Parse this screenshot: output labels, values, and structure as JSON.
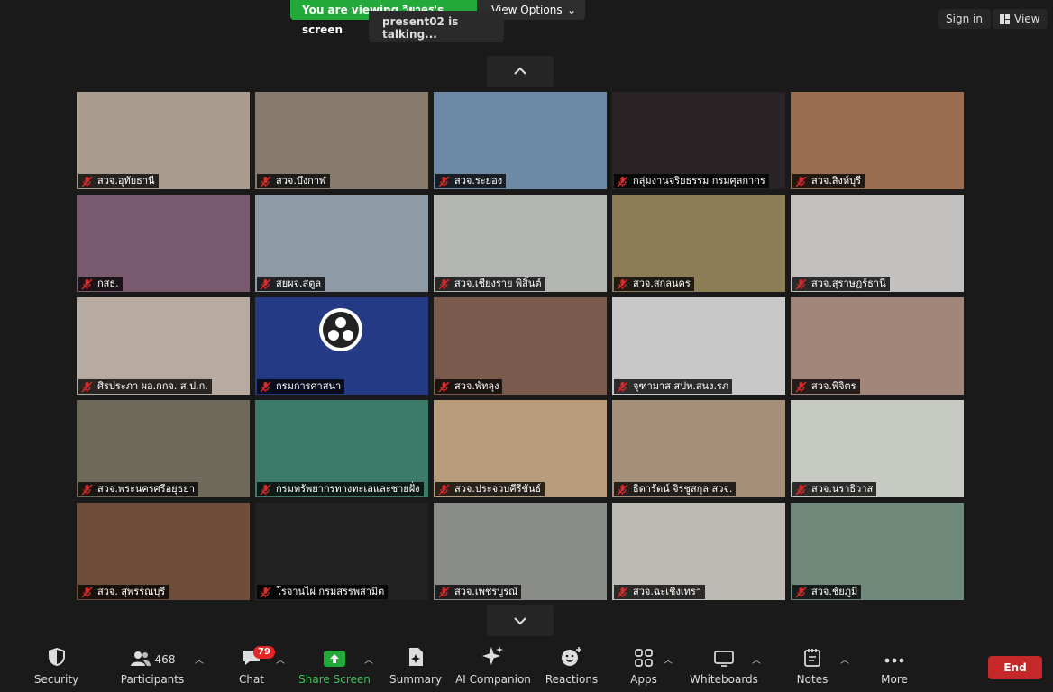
{
  "banner": {
    "viewing_text": "You are viewing วิยาคร's screen",
    "view_options_label": "View Options",
    "talking_text": "present02 is talking..."
  },
  "top_right": {
    "sign_in_label": "Sign in",
    "view_label": "View"
  },
  "participants_grid": [
    {
      "name": "สวจ.อุทัยธานี",
      "bg": "#a99b8e"
    },
    {
      "name": "สวจ.บึงกาฬ",
      "bg": "#857a6b"
    },
    {
      "name": "สวจ.ระยอง",
      "bg": "#6c8aa6"
    },
    {
      "name": "กลุ่มงานจริยธรรม กรมศุลกากร",
      "bg": "#2a2426"
    },
    {
      "name": "สวจ.สิงห์บุรี",
      "bg": "#9b6e52"
    },
    {
      "name": "กสธ.",
      "bg": "#7a5a6e"
    },
    {
      "name": "สยผจ.สตูล",
      "bg": "#8e9aa6"
    },
    {
      "name": "สวจ.เชียงราย พิสิ้นต์",
      "bg": "#b2b5b0"
    },
    {
      "name": "สวจ.สกลนคร",
      "bg": "#8c7d57"
    },
    {
      "name": "สวจ.สุราษฎร์ธานี",
      "bg": "#c3c1bf"
    },
    {
      "name": "ศิรประภา ผอ.กกจ. ส.ป.ก.",
      "bg": "#b7aaa0"
    },
    {
      "name": "กรมการศาสนา",
      "bg": "#253a84"
    },
    {
      "name": "สวจ.พัทลุง",
      "bg": "#7b5a4e"
    },
    {
      "name": "จุฑามาส สปท.สนง.รภ",
      "bg": "#c9c8c8"
    },
    {
      "name": "สวจ.พิจิตร",
      "bg": "#a3867a"
    },
    {
      "name": "สวจ.พระนครศรีอยุธยา",
      "bg": "#6f6959"
    },
    {
      "name": "กรมทรัพยากรทางทะเลและชายฝั่ง",
      "bg": "#3c7a6a"
    },
    {
      "name": "สวจ.ประจวบคีรีขันธ์",
      "bg": "#b99c7c"
    },
    {
      "name": "ธิดารัตน์ จิรชูสกุล สวจ.",
      "bg": "#a68f78"
    },
    {
      "name": "สวจ.นราธิวาส",
      "bg": "#c7c9c3"
    },
    {
      "name": "สวจ. สุพรรณบุรี",
      "bg": "#6e4e3a"
    },
    {
      "name": "โรจานไผ่ กรมสรรพสามิต",
      "bg": "#222222"
    },
    {
      "name": "สวจ.เพชรบูรณ์",
      "bg": "#8a8c88"
    },
    {
      "name": "สวจ.ฉะเชิงเทรา",
      "bg": "#bdb9b3"
    },
    {
      "name": "สวจ.ชัยภูมิ",
      "bg": "#6f8a7a"
    }
  ],
  "toolbar": {
    "security_label": "Security",
    "participants_label": "Participants",
    "participants_count": "468",
    "chat_label": "Chat",
    "chat_badge": "79",
    "share_label": "Share Screen",
    "summary_label": "Summary",
    "ai_label": "AI Companion",
    "reactions_label": "Reactions",
    "apps_label": "Apps",
    "whiteboards_label": "Whiteboards",
    "notes_label": "Notes",
    "more_label": "More",
    "end_label": "End"
  },
  "colors": {
    "accent_green": "#23a93a",
    "end_red": "#c52828",
    "badge_red": "#e02828"
  }
}
